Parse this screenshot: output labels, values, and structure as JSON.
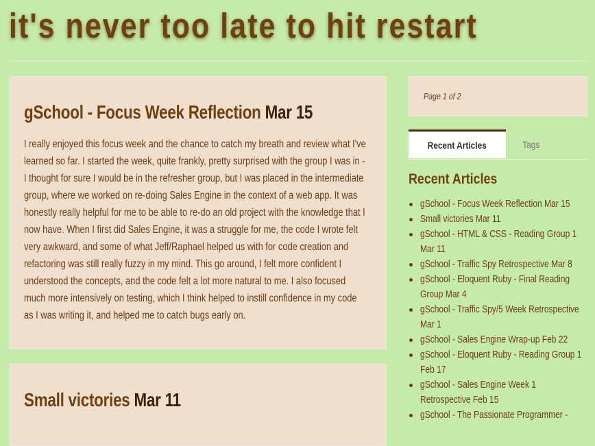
{
  "site": {
    "title": "it's never too late to hit restart"
  },
  "posts": [
    {
      "title": "gSchool - Focus Week Reflection",
      "date": "Mar 15",
      "body": "I really enjoyed this focus week and the chance to catch my breath and review what I've learned so far. I started the week, quite frankly, pretty surprised with the group I was in - I thought for sure I would be in the refresher group, but I was placed in the intermediate group, where we worked on re-doing Sales Engine in the context of a web app. It was honestly really helpful for me to be able to re-do an old project with the knowledge that I now have. When I first did Sales Engine, it was a struggle for me, the code I wrote felt very awkward, and some of what Jeff/Raphael helped us with for code creation and refactoring was still really fuzzy in my mind. This go around, I felt more confident I understood the concepts, and the code felt a lot more natural to me. I also focused much more intensively on testing, which I think helped to instill confidence in my code as I was writing it, and helped me to catch bugs early on."
    },
    {
      "title": "Small victories",
      "date": "Mar 11"
    }
  ],
  "sidebar": {
    "pager": "Page 1 of 2",
    "tabs": [
      "Recent Articles",
      "Tags"
    ],
    "heading": "Recent Articles",
    "articles": [
      "gSchool - Focus Week Reflection Mar 15",
      "Small victories Mar 11",
      "gSchool - HTML & CSS - Reading Group 1 Mar 11",
      "gSchool - Traffic Spy Retrospective Mar 8",
      "gSchool - Eloquent Ruby - Final Reading Group Mar 4",
      "gSchool - Traffic Spy/5 Week Retrospective Mar 1",
      "gSchool - Sales Engine Wrap-up Feb 22",
      "gSchool - Eloquent Ruby - Reading Group 1 Feb 17",
      "gSchool - Sales Engine Week 1 Retrospective Feb 15",
      "gSchool - The Passionate Programmer -"
    ]
  }
}
